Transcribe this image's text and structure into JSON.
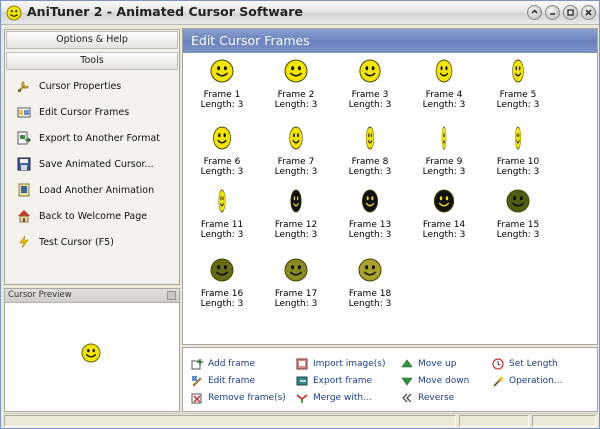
{
  "window": {
    "title": "AniTuner 2 - Animated Cursor Software",
    "controls": [
      "help-icon",
      "minimize-icon",
      "maximize-icon",
      "close-icon"
    ]
  },
  "sidebar": {
    "options_header": "Options & Help",
    "tools_header": "Tools",
    "items": [
      {
        "label": "Cursor Properties",
        "icon": "wrench-icon"
      },
      {
        "label": "Edit Cursor Frames",
        "icon": "edit-frames-icon"
      },
      {
        "label": "Export to Another Format",
        "icon": "export-icon"
      },
      {
        "label": "Save Animated Cursor...",
        "icon": "save-icon"
      },
      {
        "label": "Load Another Animation",
        "icon": "load-icon"
      },
      {
        "label": "Back to Welcome Page",
        "icon": "home-icon"
      },
      {
        "label": "Test Cursor (F5)",
        "icon": "lightning-icon"
      }
    ]
  },
  "preview": {
    "title": "Cursor Preview"
  },
  "main": {
    "title": "Edit Cursor Frames",
    "frames": [
      {
        "name": "Frame 1",
        "length": "Length: 3"
      },
      {
        "name": "Frame 2",
        "length": "Length: 3"
      },
      {
        "name": "Frame 3",
        "length": "Length: 3"
      },
      {
        "name": "Frame 4",
        "length": "Length: 3"
      },
      {
        "name": "Frame 5",
        "length": "Length: 3"
      },
      {
        "name": "Frame 6",
        "length": "Length: 3"
      },
      {
        "name": "Frame 7",
        "length": "Length: 3"
      },
      {
        "name": "Frame 8",
        "length": "Length: 3"
      },
      {
        "name": "Frame 9",
        "length": "Length: 3"
      },
      {
        "name": "Frame 10",
        "length": "Length: 3"
      },
      {
        "name": "Frame 11",
        "length": "Length: 3"
      },
      {
        "name": "Frame 12",
        "length": "Length: 3"
      },
      {
        "name": "Frame 13",
        "length": "Length: 3"
      },
      {
        "name": "Frame 14",
        "length": "Length: 3"
      },
      {
        "name": "Frame 15",
        "length": "Length: 3"
      },
      {
        "name": "Frame 16",
        "length": "Length: 3"
      },
      {
        "name": "Frame 17",
        "length": "Length: 3"
      },
      {
        "name": "Frame 18",
        "length": "Length: 3"
      }
    ]
  },
  "actions": [
    {
      "label": "Add frame",
      "icon": "add-frame-icon"
    },
    {
      "label": "Edit frame",
      "icon": "edit-frame-icon"
    },
    {
      "label": "Remove frame(s)",
      "icon": "remove-frame-icon"
    },
    {
      "label": "Import image(s)",
      "icon": "import-icon"
    },
    {
      "label": "Export frame",
      "icon": "export-frame-icon"
    },
    {
      "label": "Merge with...",
      "icon": "merge-icon"
    },
    {
      "label": "Move up",
      "icon": "arrow-up-icon"
    },
    {
      "label": "Move down",
      "icon": "arrow-down-icon"
    },
    {
      "label": "Reverse",
      "icon": "reverse-icon"
    },
    {
      "label": "Set Length",
      "icon": "clock-icon"
    },
    {
      "label": "Operation...",
      "icon": "magic-wand-icon"
    }
  ],
  "colors": {
    "header_blue": "#6a83bd",
    "link_blue": "#1a3e8f",
    "smiley_yellow": "#f2e600"
  }
}
